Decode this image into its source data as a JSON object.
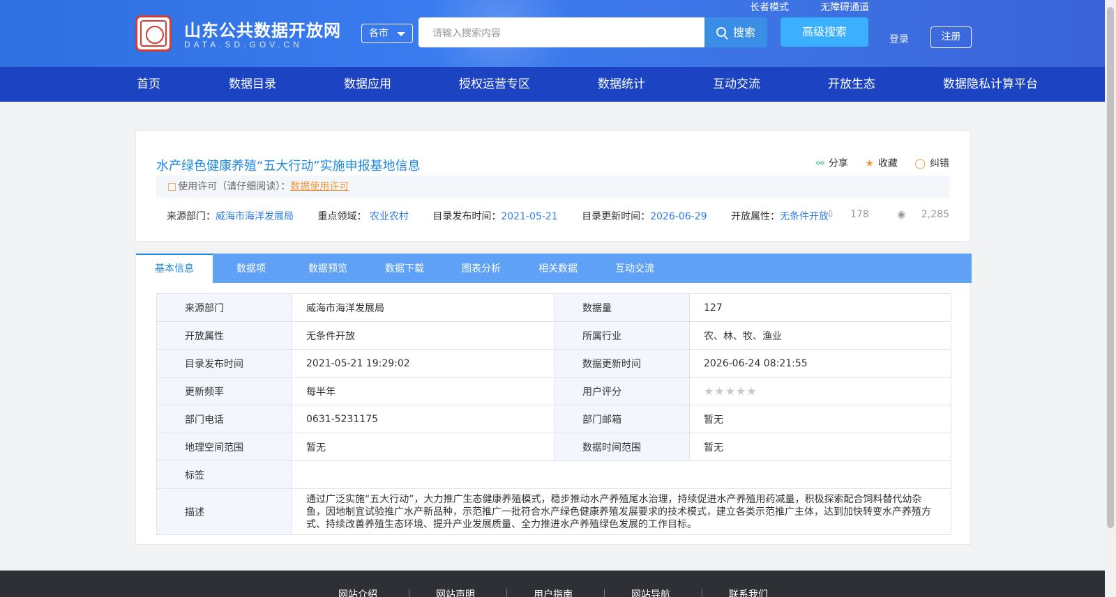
{
  "header": {
    "site_title": "山东公共数据开放网",
    "site_subtitle": "DATA.SD.GOV.CN",
    "city_select": "各市",
    "search_placeholder": "请输入搜索内容",
    "search_button": "搜索",
    "advanced_search": "高级搜索",
    "elder_mode": "长者模式",
    "accessibility": "无障碍通道",
    "login": "登录",
    "register": "注册"
  },
  "nav": {
    "items": [
      "首页",
      "数据目录",
      "数据应用",
      "授权运营专区",
      "数据统计",
      "互动交流",
      "开放生态",
      "数据隐私计算平台"
    ]
  },
  "dataset": {
    "title": "水产绿色健康养殖“五大行动”实施申报基地信息",
    "actions": {
      "share": "分享",
      "favorite": "收藏",
      "correct": "纠错"
    },
    "license_label": "使用许可（请仔细阅读）：",
    "license_link": "数据使用许可",
    "meta": {
      "source_label": "来源部门：",
      "source_value": "威海市海洋发展局",
      "domain_label": "重点领域：",
      "domain_value": "农业农村",
      "publish_label": "目录发布时间：",
      "publish_value": "2021-05-21",
      "update_label": "目录更新时间：",
      "update_value": "2026-06-29",
      "open_label": "开放属性：",
      "open_value": "无条件开放"
    },
    "downloads": "178",
    "views": "2,285"
  },
  "tabs": [
    "基本信息",
    "数据项",
    "数据预览",
    "数据下载",
    "图表分析",
    "相关数据",
    "互动交流"
  ],
  "info_table": {
    "rows": [
      {
        "k1": "来源部门",
        "v1": "威海市海洋发展局",
        "k2": "数据量",
        "v2": "127"
      },
      {
        "k1": "开放属性",
        "v1": "无条件开放",
        "k2": "所属行业",
        "v2": "农、林、牧、渔业"
      },
      {
        "k1": "目录发布时间",
        "v1": "2021-05-21 19:29:02",
        "k2": "数据更新时间",
        "v2": "2026-06-24 08:21:55"
      },
      {
        "k1": "更新频率",
        "v1": "每半年",
        "k2": "用户评分",
        "v2": ""
      },
      {
        "k1": "部门电话",
        "v1": "0631-5231175",
        "k2": "部门邮箱",
        "v2": "暂无"
      },
      {
        "k1": "地理空间范围",
        "v1": "暂无",
        "k2": "数据时间范围",
        "v2": "暂无"
      }
    ],
    "rating": 0,
    "rating_max": 5,
    "tag_label": "标签",
    "tag_value": "",
    "desc_label": "描述",
    "desc_value": "通过广泛实施“五大行动”，大力推广生态健康养殖模式，稳步推动水产养殖尾水治理，持续促进水产养殖用药减量，积极探索配合饲料替代幼杂鱼，因地制宜试验推广水产新品种，示范推广一批符合水产绿色健康养殖发展要求的技术模式，建立各类示范推广主体，达到加快转变水产养殖方式、持续改善养殖生态环境、提升产业发展质量、全力推进水产养殖绿色发展的工作目标。"
  },
  "footer": {
    "links": [
      "网站介绍",
      "网站声明",
      "用户指南",
      "网站导航",
      "联系我们"
    ]
  },
  "colors": {
    "header_blue": "#3a7cf0",
    "nav_blue": "#1b43c2",
    "tab_blue": "#5ea1f7",
    "link_blue": "#1e88e5",
    "license_orange": "#f29a38"
  }
}
